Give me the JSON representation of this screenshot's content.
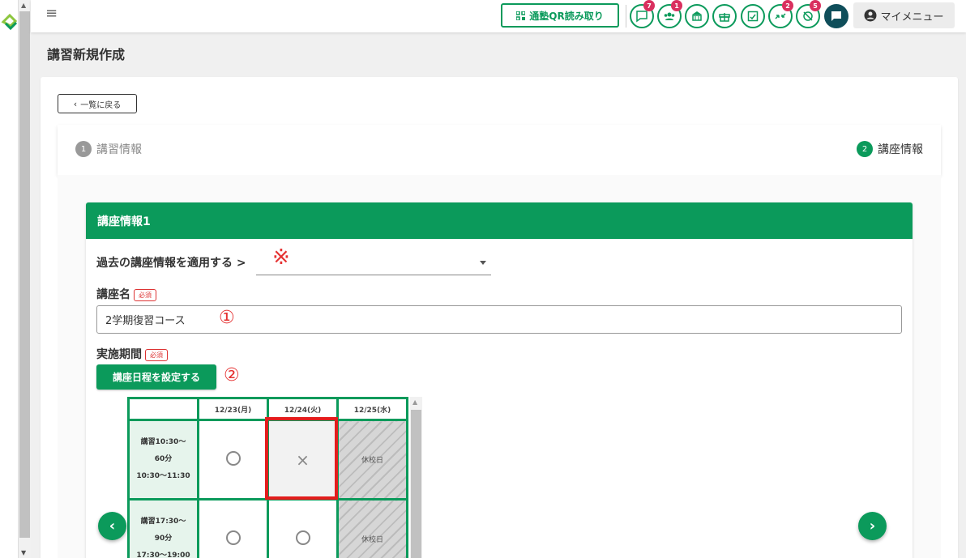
{
  "header": {
    "qr_button_label": "通塾QR読み取り",
    "icons": [
      {
        "name": "message-icon",
        "badge": "7"
      },
      {
        "name": "group-icon",
        "badge": "1"
      },
      {
        "name": "school-icon",
        "badge": ""
      },
      {
        "name": "gift-icon",
        "badge": ""
      },
      {
        "name": "document-icon",
        "badge": ""
      },
      {
        "name": "transfer-icon",
        "badge": "2"
      },
      {
        "name": "location-off-icon",
        "badge": "5"
      }
    ],
    "my_menu_label": "マイメニュー"
  },
  "page": {
    "title": "講習新規作成",
    "back_label": "一覧に戻る"
  },
  "stepper": {
    "step1": {
      "num": "1",
      "label": "講習情報"
    },
    "step2": {
      "num": "2",
      "label": "講座情報"
    }
  },
  "panel": {
    "title": "講座情報1",
    "apply_past_label": "過去の講座情報を適用する >",
    "kome_mark": "※",
    "course_name_label": "講座名",
    "required_label": "必須",
    "course_name_value": "2学期復習コース",
    "period_label": "実施期間",
    "set_schedule_label": "講座日程を設定する",
    "annotations": {
      "one": "①",
      "two": "②"
    }
  },
  "schedule": {
    "dates": [
      "12/23(月)",
      "12/24(火)",
      "12/25(水)"
    ],
    "rows": [
      {
        "lines": [
          "講習10:30〜",
          "60分",
          "10:30〜11:30"
        ],
        "cells": [
          "○",
          "×",
          "休校日"
        ]
      },
      {
        "lines": [
          "講習17:30〜",
          "90分",
          "17:30〜19:00"
        ],
        "cells": [
          "○",
          "○",
          "休校日"
        ]
      }
    ]
  },
  "colors": {
    "brand": "#0b9a5b",
    "badge": "#d9305f",
    "annotation": "#e53232"
  }
}
